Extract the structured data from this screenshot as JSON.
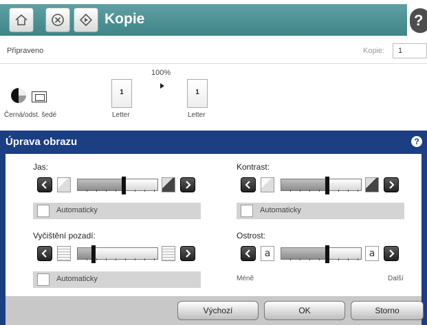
{
  "header": {
    "title": "Kopie",
    "help": "?"
  },
  "status": {
    "ready_text": "Připraveno",
    "copies_label": "Kopie:",
    "copies_value": "1",
    "zoom": "100%",
    "source_page_count": "1",
    "source_page_size": "Letter",
    "output_page_count": "1",
    "output_page_size": "Letter",
    "color_mode": "Černá/odst. šedé"
  },
  "panel": {
    "title": "Úprava obrazu",
    "help": "?",
    "brightness": {
      "label": "Jas:",
      "level": 0.58,
      "auto_label": "Automaticky"
    },
    "contrast": {
      "label": "Kontrast:",
      "level": 0.58,
      "auto_label": "Automaticky"
    },
    "background_cleanup": {
      "label": "Vyčištění pozadí:",
      "level": 0.2,
      "auto_label": "Automaticky"
    },
    "sharpness": {
      "label": "Ostrost:",
      "level": 0.58,
      "icon_letter": "a",
      "less_label": "Méně",
      "more_label": "Další"
    },
    "buttons": {
      "default": "Výchozí",
      "ok": "OK",
      "cancel": "Storno"
    }
  },
  "colors": {
    "header_teal": "#3e8488",
    "panel_blue": "#1c3e82"
  },
  "icons": [
    "home-icon",
    "stop-icon",
    "start-icon",
    "help-icon",
    "chevron-left-icon",
    "chevron-right-icon"
  ]
}
